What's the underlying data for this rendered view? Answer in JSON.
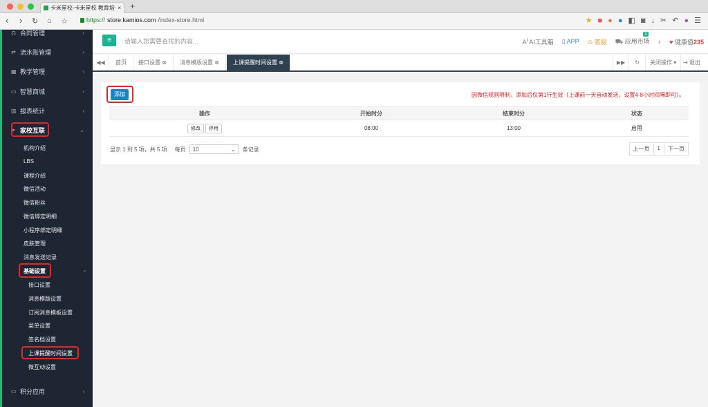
{
  "browser": {
    "tab_title": "卡米星校-卡米星校 教育培训机",
    "url_https": "https://",
    "url_host": "store.kamios.com",
    "url_path": "/index-store.html",
    "new_tab": "+"
  },
  "sidebar": {
    "top_items": [
      {
        "label": "合同管理"
      },
      {
        "label": "流水账管理"
      },
      {
        "label": "教学管理"
      },
      {
        "label": "智慧商城"
      },
      {
        "label": "报表统计"
      },
      {
        "label": "家校互联"
      }
    ],
    "sub_items": [
      "机构介绍",
      "LBS",
      "课程介绍",
      "微信活动",
      "微信粉丝",
      "微信绑定明细",
      "小程序绑定明细",
      "皮肤管理",
      "消息发送记录",
      "基础设置"
    ],
    "sub2_items": [
      "接口设置",
      "消息模版设置",
      "订阅消息模板设置",
      "菜单设置",
      "签名档设置",
      "上课提醒时间设置",
      "微互动设置"
    ],
    "bottom_item": "积分应用"
  },
  "topbar": {
    "search_placeholder": "请输入您需要查找的内容...",
    "ai_tools": "AI工具箱",
    "app": "APP",
    "service": "客服",
    "market": "应用市场",
    "notif_count": "1",
    "health_label": "健康值",
    "health_value": "235"
  },
  "tabs": [
    {
      "label": "首页"
    },
    {
      "label": "接口设置 ⊗"
    },
    {
      "label": "消息模版设置 ⊗"
    },
    {
      "label": "上课提醒时间设置 ⊗"
    }
  ],
  "tab_tools": {
    "close_ops": "关闭操作",
    "logout": "退出"
  },
  "content": {
    "add_button": "添加",
    "notice": "因微信规则限制，添加后仅第1行生效（上课前一天自动发送，设置4-8小时间隔即可）。",
    "columns": [
      "操作",
      "开始时分",
      "结束时分",
      "状态"
    ],
    "row": {
      "edit": "修改",
      "disable": "停用",
      "start": "08:00",
      "end": "13:00",
      "status": "启用"
    },
    "info_text": "显示 1 到 5 项，共 5 项",
    "per_page_label": "每页",
    "per_page_value": "10",
    "per_page_suffix": "条记录",
    "pager": {
      "prev": "上一页",
      "page": "1",
      "next": "下一页"
    }
  }
}
